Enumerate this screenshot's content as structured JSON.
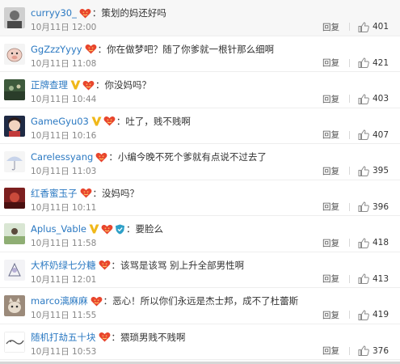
{
  "ui": {
    "reply_label": "回复"
  },
  "comments": [
    {
      "user": "curryy30_",
      "vip": false,
      "shield": false,
      "text": "策划的妈还好吗",
      "time": "10月11日 12:00",
      "likes": "401",
      "avatar": "avatar-gray"
    },
    {
      "user": "GgZzzYyyy",
      "vip": false,
      "shield": false,
      "text": "你在做梦吧？随了你爹就一根针那么细啊",
      "time": "10月11日 11:08",
      "likes": "421",
      "avatar": "avatar-pig"
    },
    {
      "user": "正牌查理",
      "vip": true,
      "shield": false,
      "text": "你没妈吗？",
      "time": "10月11日 10:44",
      "likes": "403",
      "avatar": "avatar-green"
    },
    {
      "user": "GameGyu03",
      "vip": true,
      "shield": false,
      "text": "吐了，贱不贱啊",
      "time": "10月11日 10:16",
      "likes": "407",
      "avatar": "avatar-anime"
    },
    {
      "user": "Carelessyang",
      "vip": false,
      "shield": false,
      "text": "小编今晚不死个爹就有点说不过去了",
      "time": "10月11日 11:03",
      "likes": "395",
      "avatar": "avatar-umbrella"
    },
    {
      "user": "红香蜜玉子",
      "vip": false,
      "shield": false,
      "text": "没妈吗？",
      "time": "10月11日 10:11",
      "likes": "396",
      "avatar": "avatar-red"
    },
    {
      "user": "Aplus_Vable",
      "vip": true,
      "shield": true,
      "text": "要脸么",
      "time": "10月11日 11:58",
      "likes": "418",
      "avatar": "avatar-field"
    },
    {
      "user": "大杯奶绿七分糖",
      "vip": false,
      "shield": false,
      "text": "该骂是该骂 别上升全部男性啊",
      "time": "10月11日 12:01",
      "likes": "413",
      "avatar": "avatar-sketch"
    },
    {
      "user": "marco漓麻麻",
      "vip": false,
      "shield": false,
      "text": "恶心！所以你们永远是杰士邦，成不了杜蕾斯",
      "time": "10月11日 11:55",
      "likes": "419",
      "avatar": "avatar-cat"
    },
    {
      "user": "随机打劫五十块",
      "vip": false,
      "shield": false,
      "text": "猥琐男贱不贱啊",
      "time": "10月11日 10:53",
      "likes": "376",
      "avatar": "avatar-doodle"
    }
  ]
}
